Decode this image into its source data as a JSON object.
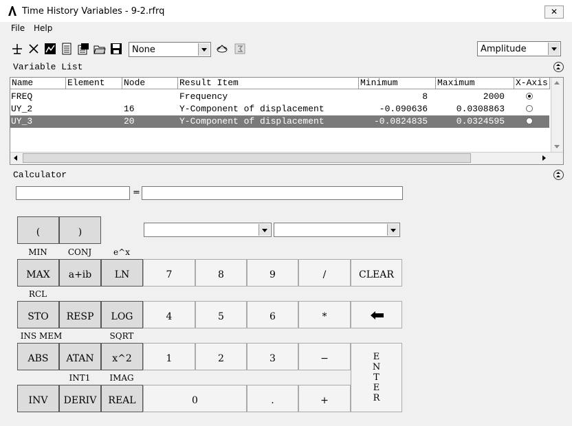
{
  "window": {
    "title": "Time History Variables - 9-2.rfrq",
    "close": "✕"
  },
  "menu": {
    "file": "File",
    "help": "Help"
  },
  "toolbar": {
    "combo1": "None",
    "combo2": "Amplitude"
  },
  "variable_list": {
    "title": "Variable List",
    "headers": [
      "Name",
      "Element",
      "Node",
      "Result Item",
      "Minimum",
      "Maximum",
      "X-Axis"
    ],
    "rows": [
      {
        "name": "FREQ",
        "element": "",
        "node": "",
        "result": "Frequency",
        "min": "8",
        "max": "2000",
        "xaxis": true
      },
      {
        "name": "UY_2",
        "element": "",
        "node": "16",
        "result": "Y-Component of displacement",
        "min": "-0.090636",
        "max": "0.0308863",
        "xaxis": false
      },
      {
        "name": "UY_3",
        "element": "",
        "node": "20",
        "result": "Y-Component of displacement",
        "min": "-0.0824835",
        "max": "0.0324595",
        "xaxis": false
      }
    ]
  },
  "calculator": {
    "title": "Calculator",
    "equals": "=",
    "keys": {
      "lparen": "(",
      "rparen": ")",
      "max": "MAX",
      "aib": "a+ib",
      "ln": "LN",
      "sto": "STO",
      "resp": "RESP",
      "log": "LOG",
      "abs": "ABS",
      "atan": "ATAN",
      "x2": "x^2",
      "inv": "INV",
      "deriv": "DERIV",
      "real": "REAL",
      "k7": "7",
      "k8": "8",
      "k9": "9",
      "div": "/",
      "clear": "CLEAR",
      "k4": "4",
      "k5": "5",
      "k6": "6",
      "mul": "*",
      "k1": "1",
      "k2": "2",
      "k3": "3",
      "minus": "−",
      "k0": "0",
      "dot": ".",
      "plus": "+",
      "enter": [
        "E",
        "N",
        "T",
        "E",
        "R"
      ]
    },
    "labels": {
      "min": "MIN",
      "conj": "CONJ",
      "ex": "e^x",
      "rcl": "RCL",
      "ins_mem": "INS MEM",
      "sqrt": "SQRT",
      "int1": "INT1",
      "imag": "IMAG"
    }
  }
}
